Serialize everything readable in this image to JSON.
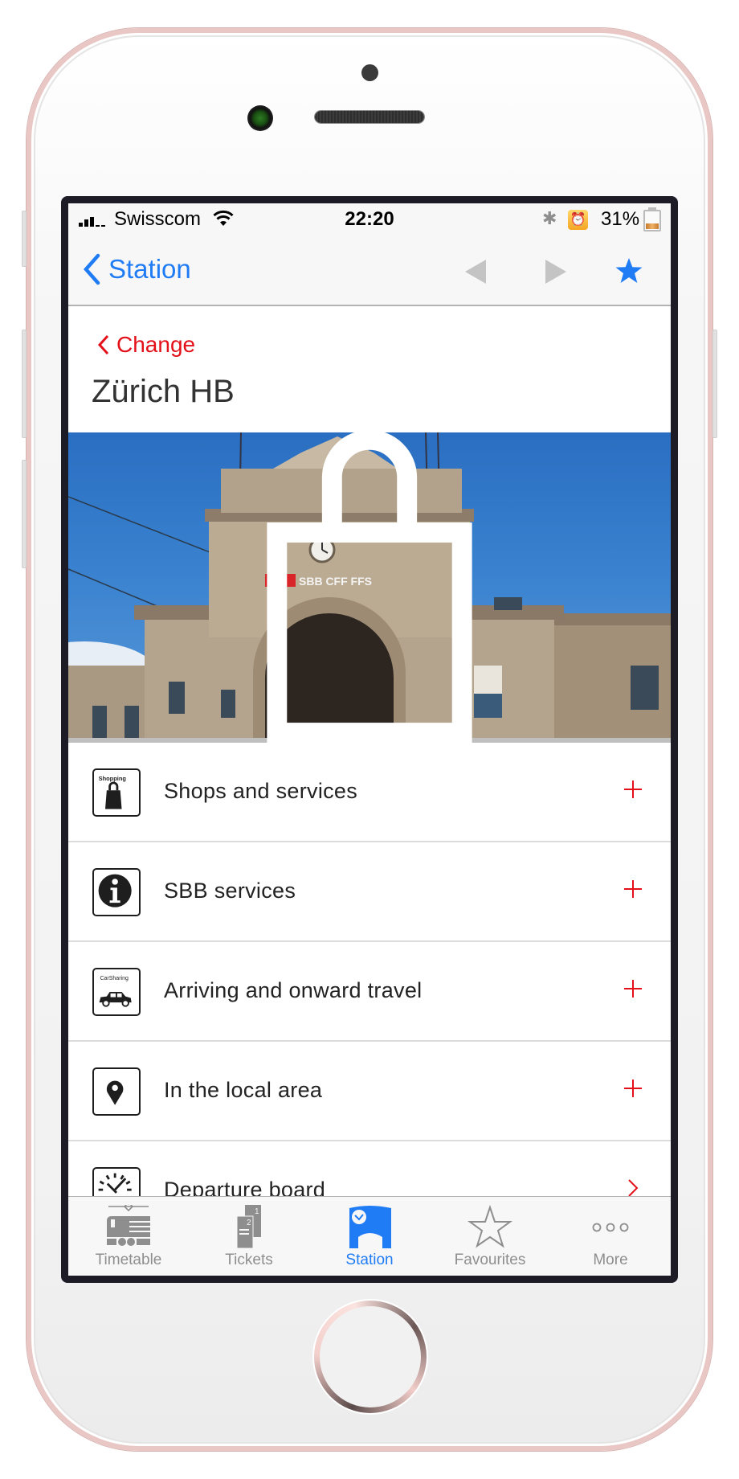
{
  "status_bar": {
    "carrier": "Swisscom",
    "time": "22:20",
    "battery_percent": "31%",
    "battery_level": 0.31,
    "signal_bars_filled": 3,
    "signal_bars_total": 5,
    "icons": [
      "signal-icon",
      "wifi-icon",
      "bluetooth-icon",
      "alarm-icon",
      "battery-icon"
    ]
  },
  "nav_bar": {
    "back_label": "Station",
    "prev_icon": "triangle-left-icon",
    "next_icon": "triangle-right-icon",
    "favourite_icon": "star-filled-icon"
  },
  "header": {
    "change_label": "Change",
    "station_name": "Zürich HB"
  },
  "photo": {
    "subject": "Zürich HB station facade",
    "sign_text": "SBB CFF FFS",
    "overlay_icon": "shopping-bag-icon"
  },
  "menu": {
    "items": [
      {
        "label": "Shops and services",
        "icon": "shopping-icon",
        "icon_caption": "Shopping",
        "action": "expand-plus"
      },
      {
        "label": "SBB services",
        "icon": "info-icon",
        "action": "expand-plus"
      },
      {
        "label": "Arriving and onward travel",
        "icon": "carsharing-icon",
        "icon_caption": "CarSharing",
        "action": "expand-plus"
      },
      {
        "label": "In the local area",
        "icon": "location-pin-icon",
        "action": "expand-plus"
      },
      {
        "label": "Departure board",
        "icon": "clock-icon",
        "action": "chevron-right"
      }
    ]
  },
  "tab_bar": {
    "active": "Station",
    "tabs": [
      {
        "label": "Timetable",
        "icon": "train-icon"
      },
      {
        "label": "Tickets",
        "icon": "tickets-icon"
      },
      {
        "label": "Station",
        "icon": "station-icon"
      },
      {
        "label": "Favourites",
        "icon": "star-outline-icon"
      },
      {
        "label": "More",
        "icon": "more-dots-icon"
      }
    ]
  },
  "colors": {
    "ios_blue": "#1f7cf5",
    "sbb_red": "#e3101a",
    "inactive_gray": "#8e8e8e",
    "phone_rose_gold": "#e9c7c5"
  }
}
